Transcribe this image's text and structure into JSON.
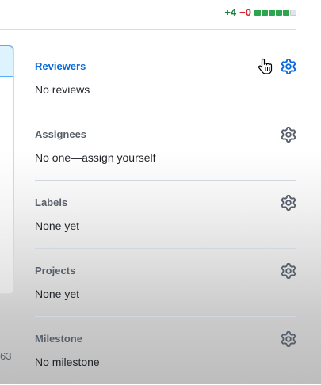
{
  "diffstat": {
    "additions": "+4",
    "deletions": "−0",
    "blocks": [
      "added",
      "added",
      "added",
      "added",
      "added",
      "neutral"
    ],
    "colors": {
      "added": "#2da44e",
      "deleted": "#cf222e",
      "neutral": "#e1e4e8"
    }
  },
  "left_edge": {
    "number": "63"
  },
  "sidebar": {
    "sections": [
      {
        "heading": "Reviewers",
        "value": "No reviews",
        "icon": "gear-icon"
      },
      {
        "heading": "Assignees",
        "value": "No one—assign yourself",
        "icon": "gear-icon"
      },
      {
        "heading": "Labels",
        "value": "None yet",
        "icon": "gear-icon"
      },
      {
        "heading": "Projects",
        "value": "None yet",
        "icon": "gear-icon"
      },
      {
        "heading": "Milestone",
        "value": "No milestone",
        "icon": "gear-icon"
      }
    ]
  },
  "colors": {
    "link": "#0969da",
    "muted": "#57606a",
    "text": "#1f2328"
  }
}
